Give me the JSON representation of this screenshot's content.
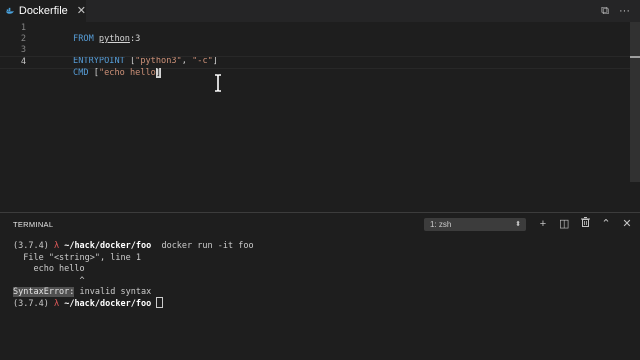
{
  "tab": {
    "label": "Dockerfile",
    "close_glyph": "✕"
  },
  "editor": {
    "lines": [
      {
        "num": "1",
        "tokens": [
          {
            "t": "FROM ",
            "c": "kw"
          },
          {
            "t": "python",
            "c": "plain under"
          },
          {
            "t": ":3",
            "c": "plain"
          }
        ]
      },
      {
        "num": "2",
        "tokens": []
      },
      {
        "num": "3",
        "tokens": [
          {
            "t": "ENTRYPOINT ",
            "c": "kw"
          },
          {
            "t": "[",
            "c": "plain"
          },
          {
            "t": "\"python3\"",
            "c": "str"
          },
          {
            "t": ", ",
            "c": "plain"
          },
          {
            "t": "\"-c\"",
            "c": "str"
          },
          {
            "t": "]",
            "c": "plain"
          }
        ]
      },
      {
        "num": "4",
        "tokens": [
          {
            "t": "CMD ",
            "c": "kw"
          },
          {
            "t": "[",
            "c": "plain"
          },
          {
            "t": "\"echo hello",
            "c": "str"
          }
        ]
      }
    ],
    "line4_cursor_char": "]"
  },
  "panel": {
    "title": "TERMINAL",
    "terminal_select": "1: zsh",
    "select_arrow": "⬍"
  },
  "terminal": {
    "prompt_env": "(3.7.4) ",
    "lambda": "λ",
    "prompt_path": "~/hack/docker/foo",
    "command": "docker run -it foo",
    "out1": "  File \"<string>\", line 1",
    "out2": "    echo hello",
    "out3": "             ^",
    "error_name": "SyntaxError:",
    "error_msg": " invalid syntax"
  },
  "icons": {
    "split": "⧉",
    "more": "···",
    "add": "+",
    "split_terminal": "◫",
    "trash": "🗑",
    "chevron_up": "⌃",
    "close": "✕"
  },
  "colors": {
    "keyword": "#569cd6",
    "string": "#ce9178",
    "lambda": "#e05a5a"
  }
}
